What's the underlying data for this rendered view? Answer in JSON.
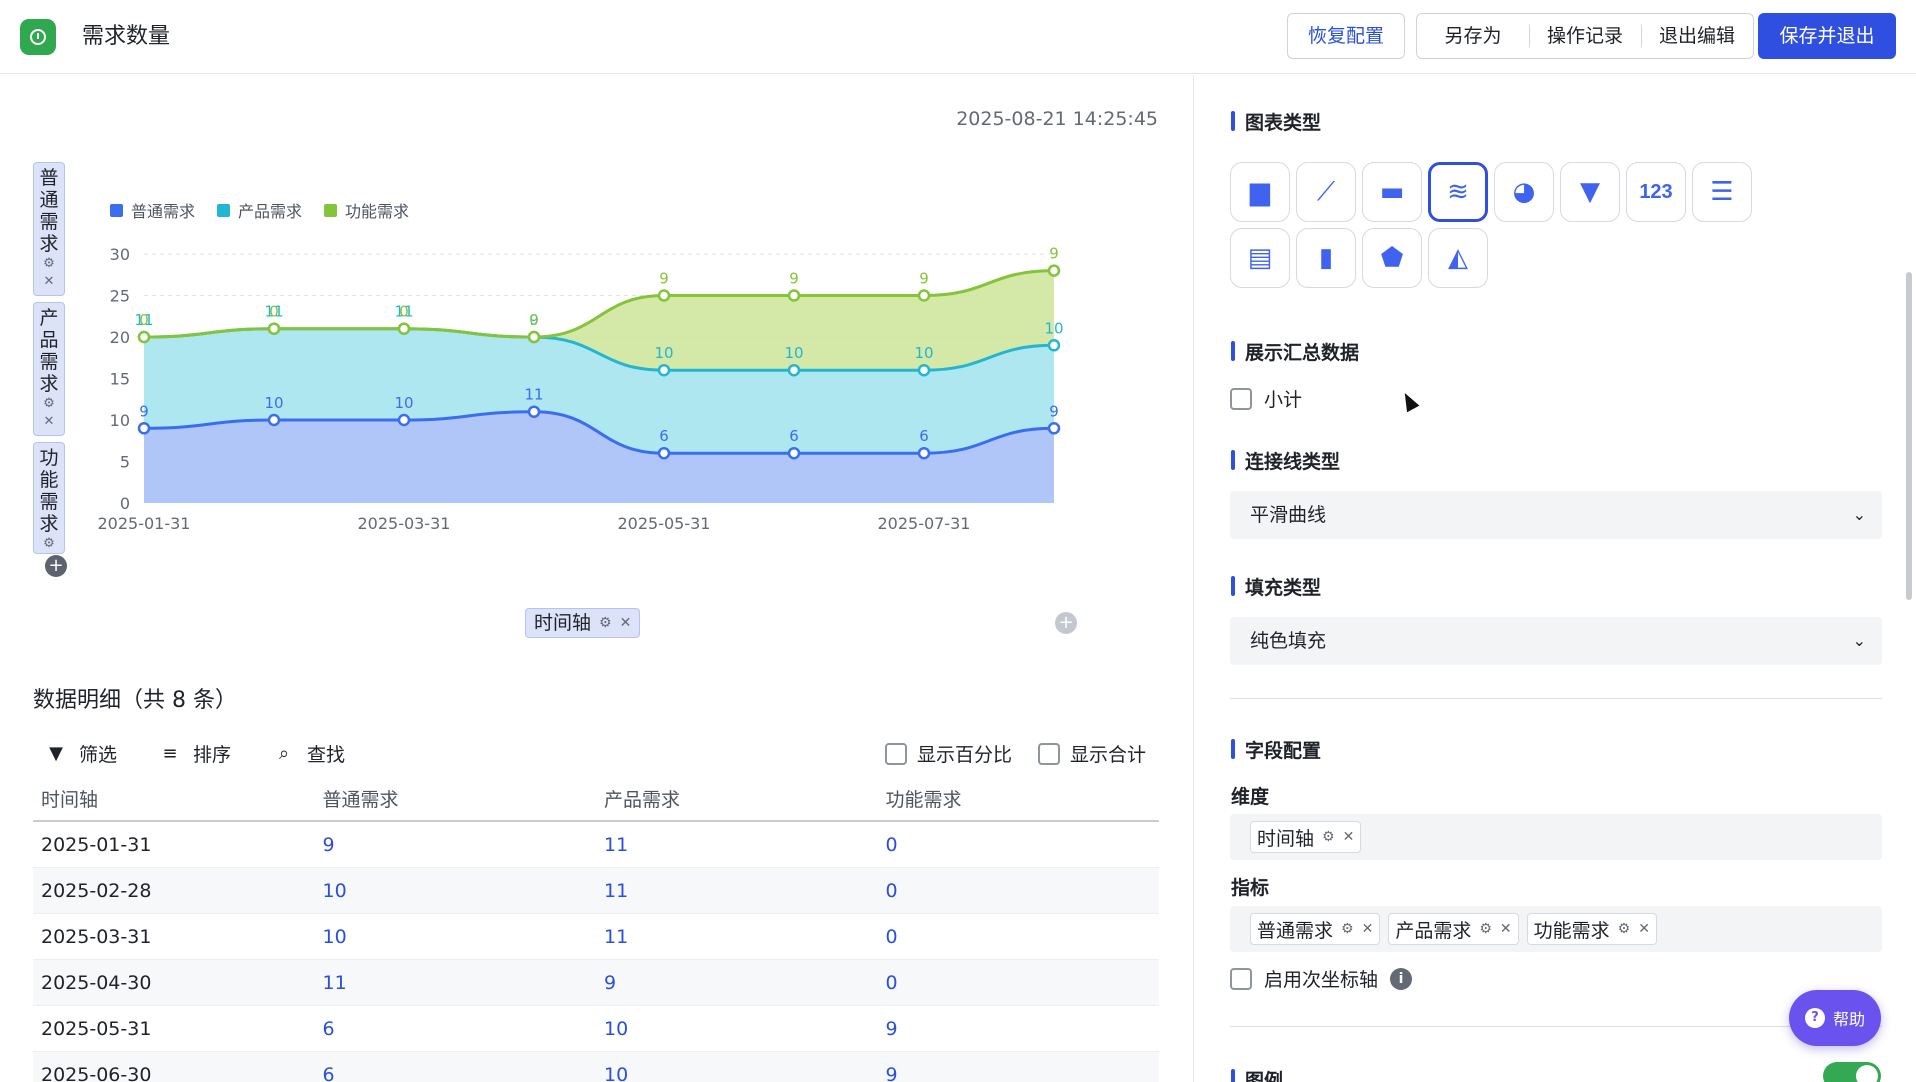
{
  "header": {
    "title": "需求数量",
    "restore_label": "恢复配置",
    "save_as_label": "另存为",
    "history_label": "操作记录",
    "exit_edit_label": "退出编辑",
    "save_exit_label": "保存并退出"
  },
  "main": {
    "timestamp": "2025-08-21 14:25:45",
    "y_fields": [
      {
        "label": "普通需求"
      },
      {
        "label": "产品需求"
      },
      {
        "label": "功能需求"
      }
    ],
    "x_field": "时间轴",
    "detail_title": "数据明细（共 8 条）",
    "toolbar": {
      "filter": "筛选",
      "sort": "排序",
      "find": "查找"
    },
    "show_percent": "显示百分比",
    "show_total": "显示合计",
    "table": {
      "headers": [
        "时间轴",
        "普通需求",
        "产品需求",
        "功能需求"
      ],
      "rows": [
        [
          "2025-01-31",
          "9",
          "11",
          "0"
        ],
        [
          "2025-02-28",
          "10",
          "11",
          "0"
        ],
        [
          "2025-03-31",
          "10",
          "11",
          "0"
        ],
        [
          "2025-04-30",
          "11",
          "9",
          "0"
        ],
        [
          "2025-05-31",
          "6",
          "10",
          "9"
        ],
        [
          "2025-06-30",
          "6",
          "10",
          "9"
        ]
      ]
    }
  },
  "chart_data": {
    "type": "area",
    "stacked": true,
    "smooth": true,
    "x": [
      "2025-01-31",
      "2025-02-28",
      "2025-03-31",
      "2025-04-30",
      "2025-05-31",
      "2025-06-30",
      "2025-07-31",
      "2025-08-21"
    ],
    "x_tick_labels": [
      "2025-01-31",
      "2025-03-31",
      "2025-05-31",
      "2025-07-31"
    ],
    "series": [
      {
        "name": "普通需求",
        "color": "#3b6df0",
        "fill": "#a9c0f7",
        "values": [
          9,
          10,
          10,
          11,
          6,
          6,
          6,
          9
        ]
      },
      {
        "name": "产品需求",
        "color": "#22b6d3",
        "fill": "#a6e4f0",
        "values": [
          11,
          11,
          11,
          9,
          10,
          10,
          10,
          10
        ]
      },
      {
        "name": "功能需求",
        "color": "#85c43a",
        "fill": "#cfe69d",
        "values": [
          0,
          0,
          0,
          0,
          9,
          9,
          9,
          9
        ]
      }
    ],
    "ylim": [
      0,
      30
    ],
    "y_ticks": [
      "0",
      "5",
      "10",
      "15",
      "20",
      "25",
      "30"
    ],
    "grid": true,
    "legend_position": "top-left"
  },
  "panel": {
    "chart_type_title": "图表类型",
    "chart_types": [
      {
        "icon": "bar-chart-icon",
        "glyph": "▆"
      },
      {
        "icon": "line-chart-icon",
        "glyph": "⟋"
      },
      {
        "icon": "horizontal-bar-icon",
        "glyph": "▬"
      },
      {
        "icon": "area-chart-icon",
        "glyph": "≋",
        "active": true
      },
      {
        "icon": "pie-chart-icon",
        "glyph": "◕"
      },
      {
        "icon": "funnel-chart-icon",
        "glyph": "▼"
      },
      {
        "icon": "number-card-icon",
        "glyph": "123"
      },
      {
        "icon": "list-icon",
        "glyph": "☰"
      },
      {
        "icon": "table-icon",
        "glyph": "▤"
      },
      {
        "icon": "column-chart-icon",
        "glyph": "▮"
      },
      {
        "icon": "radar-chart-icon",
        "glyph": "⬟"
      },
      {
        "icon": "combo-chart-icon",
        "glyph": "◭"
      }
    ],
    "summary_title": "展示汇总数据",
    "subtotal_label": "小计",
    "line_type_title": "连接线类型",
    "line_type_value": "平滑曲线",
    "fill_type_title": "填充类型",
    "fill_type_value": "纯色填充",
    "field_config_title": "字段配置",
    "dimension_label": "维度",
    "dimension_chip": "时间轴",
    "metric_label": "指标",
    "metric_chips": [
      "普通需求",
      "产品需求",
      "功能需求"
    ],
    "secondary_axis_label": "启用次坐标轴",
    "legend_title": "图例",
    "help_label": "帮助"
  }
}
